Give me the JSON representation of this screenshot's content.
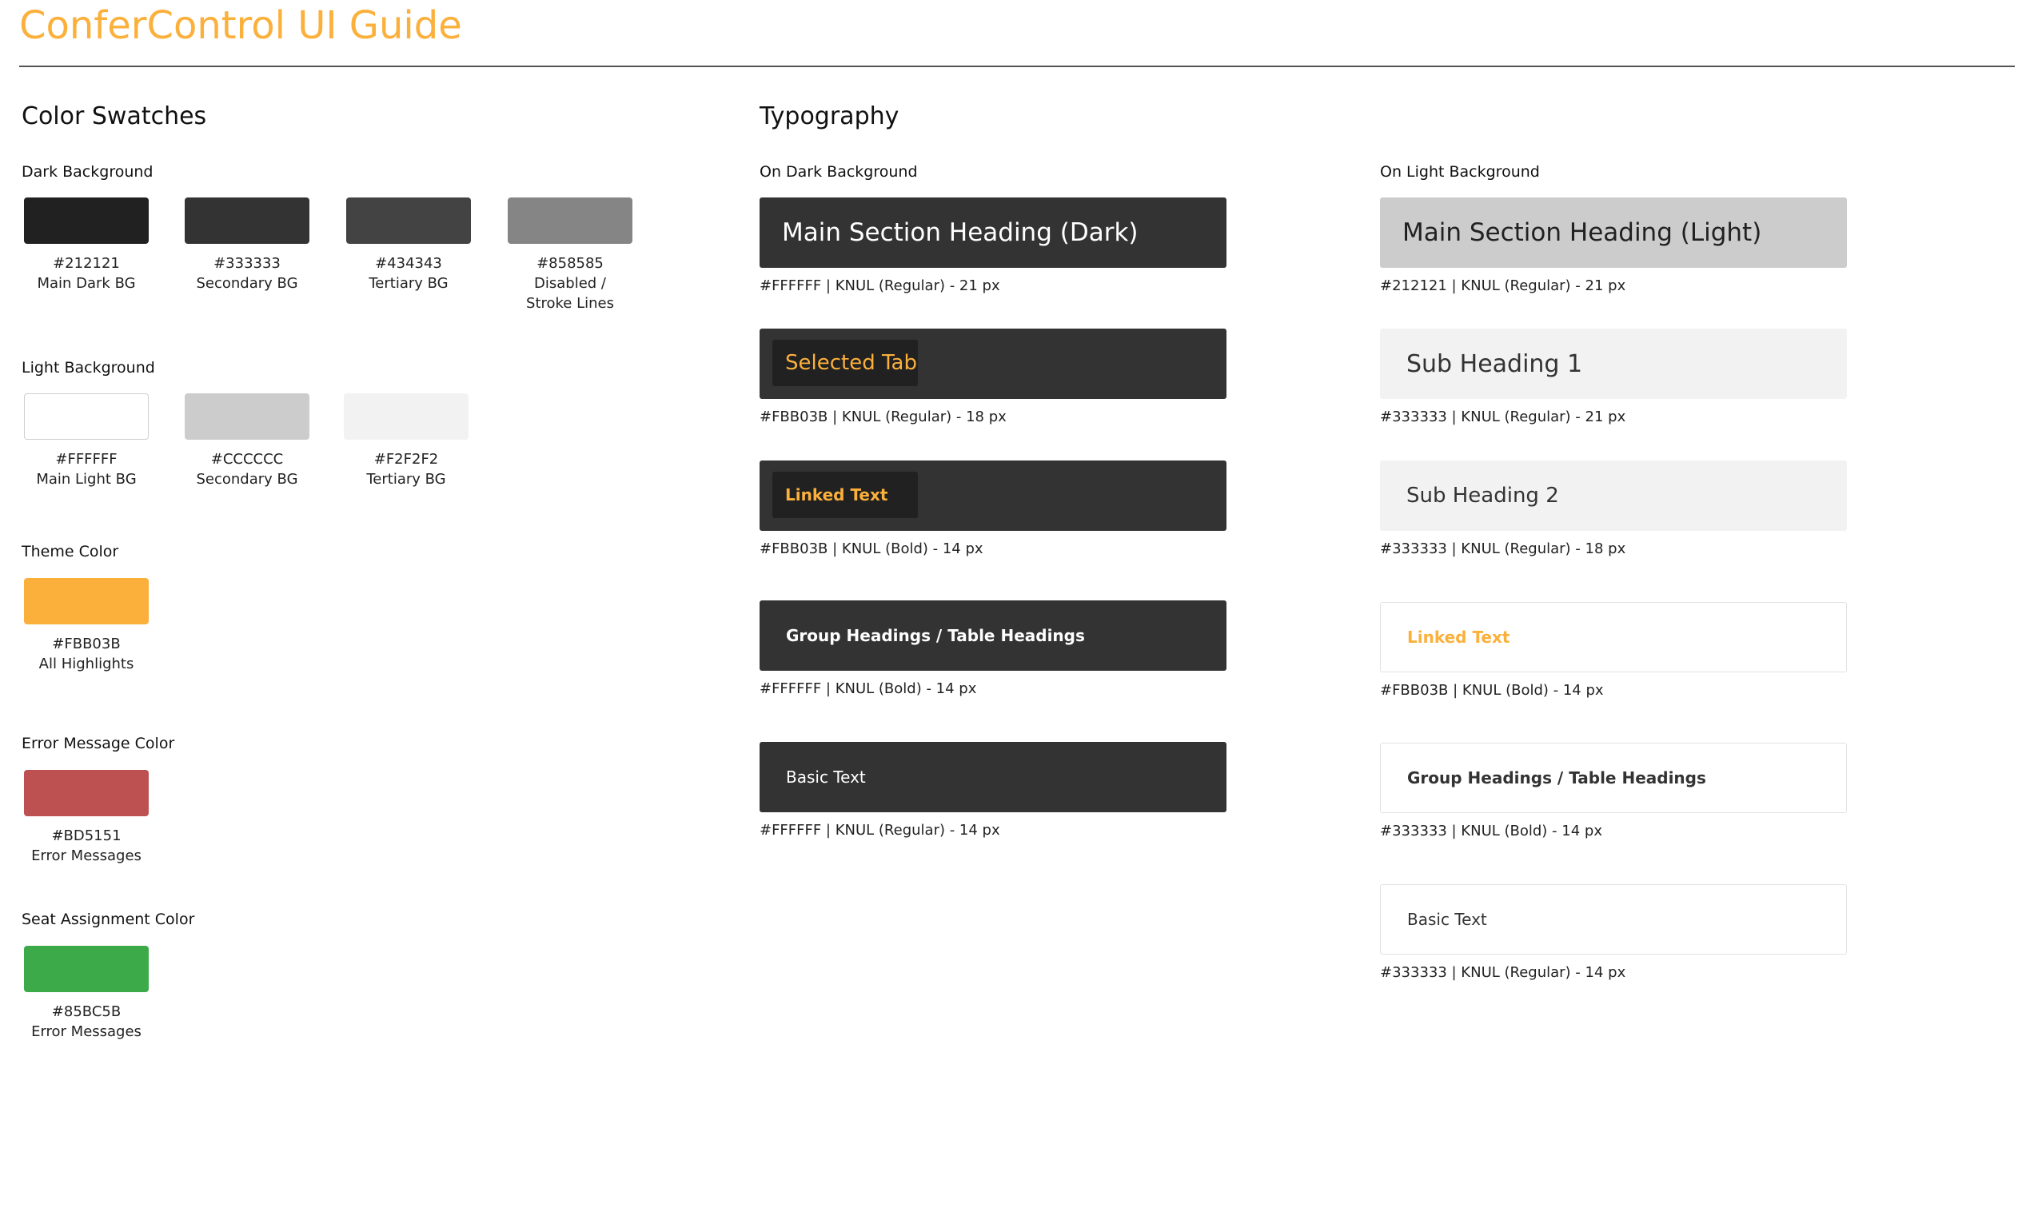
{
  "page_title": "ConferControl UI Guide",
  "swatches": {
    "heading": "Color Swatches",
    "dark": {
      "label": "Dark Background",
      "items": [
        {
          "color": "#212121",
          "hex": "#212121",
          "name": "Main Dark BG"
        },
        {
          "color": "#333333",
          "hex": "#333333",
          "name": "Secondary BG"
        },
        {
          "color": "#434343",
          "hex": "#434343",
          "name": "Tertiary BG"
        },
        {
          "color": "#858585",
          "hex": "#858585",
          "name": "Disabled /",
          "name2": "Stroke Lines"
        }
      ]
    },
    "light": {
      "label": "Light Background",
      "items": [
        {
          "color": "#FFFFFF",
          "hex": "#FFFFFF",
          "name": "Main Light BG"
        },
        {
          "color": "#CCCCCC",
          "hex": "#CCCCCC",
          "name": "Secondary BG"
        },
        {
          "color": "#F2F2F2",
          "hex": "#F2F2F2",
          "name": "Tertiary BG"
        }
      ]
    },
    "theme": {
      "label": "Theme Color",
      "color": "#FBB03B",
      "hex": "#FBB03B",
      "name": "All Highlights"
    },
    "error": {
      "label": "Error Message Color",
      "color": "#BD5151",
      "hex": "#BD5151",
      "name": "Error Messages"
    },
    "seat": {
      "label": "Seat Assignment Color",
      "color": "#3DAA4A",
      "hex": "#85BC5B",
      "name": "Error Messages"
    }
  },
  "typography": {
    "heading": "Typography",
    "dark": {
      "label": "On Dark Background",
      "samples": [
        {
          "text": "Main Section Heading (Dark)",
          "spec": "#FFFFFF |  KNUL (Regular) - 21 px"
        },
        {
          "text": "Selected Tab",
          "spec": "#FBB03B |  KNUL (Regular) - 18 px"
        },
        {
          "text": "Linked Text",
          "spec": "#FBB03B |  KNUL (Bold) - 14 px"
        },
        {
          "text": "Group Headings / Table Headings",
          "spec": "#FFFFFF |  KNUL (Bold) - 14 px"
        },
        {
          "text": "Basic Text",
          "spec": "#FFFFFF |  KNUL (Regular) - 14 px"
        }
      ]
    },
    "light": {
      "label": "On Light Background",
      "samples": [
        {
          "text": "Main Section Heading (Light)",
          "spec": "#212121 |  KNUL (Regular) - 21 px"
        },
        {
          "text": "Sub Heading 1",
          "spec": "#333333 |  KNUL (Regular) - 21 px"
        },
        {
          "text": "Sub Heading 2",
          "spec": "#333333 |  KNUL (Regular) - 18 px"
        },
        {
          "text": "Linked Text",
          "spec": "#FBB03B |  KNUL (Bold) - 14 px"
        },
        {
          "text": "Group Headings / Table Headings",
          "spec": "#333333 |  KNUL (Bold) - 14 px"
        },
        {
          "text": "Basic Text",
          "spec": "#333333 |  KNUL (Regular) - 14 px"
        }
      ]
    }
  }
}
